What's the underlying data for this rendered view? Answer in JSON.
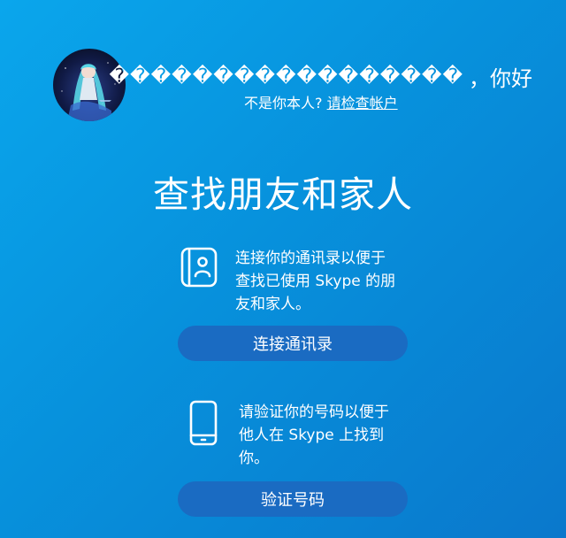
{
  "header": {
    "display_name": "�����������������",
    "greeting_suffix": "，你好",
    "not_you_text": "不是你本人?",
    "check_account_link": "请检查帐户"
  },
  "main": {
    "title": "查找朋友和家人",
    "contacts": {
      "icon": "contact-book-icon",
      "description_lines": [
        "连接你的通讯录以便于",
        "查找已使用 Skype 的朋",
        "友和家人。"
      ],
      "button_label": "连接通讯录"
    },
    "phone": {
      "icon": "smartphone-icon",
      "description_lines": [
        "请验证你的号码以便于",
        "他人在 Skype 上找到",
        "你。"
      ],
      "button_label": "验证号码"
    }
  },
  "colors": {
    "background_start": "#0aa6ec",
    "background_end": "#0a78cc",
    "button": "#1a6bc2",
    "text": "#ffffff"
  }
}
